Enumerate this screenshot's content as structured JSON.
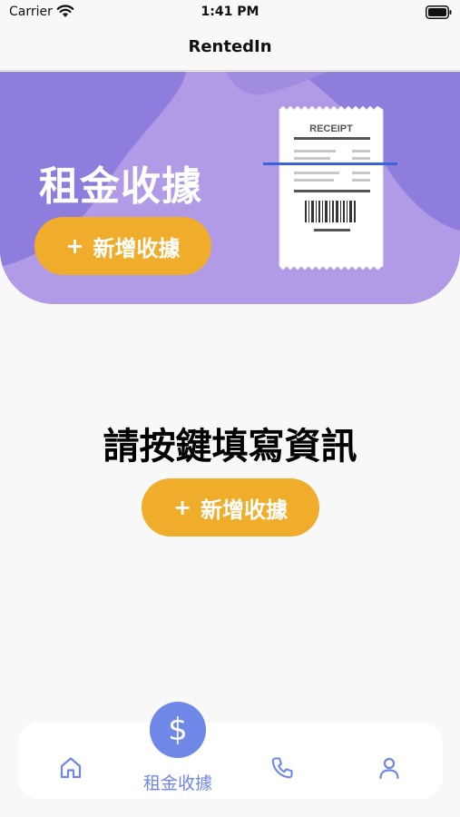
{
  "status_bar": {
    "carrier": "Carrier",
    "time": "1:41 PM",
    "icons": [
      "wifi-icon",
      "battery-icon"
    ]
  },
  "nav": {
    "title": "RentedIn"
  },
  "banner": {
    "title": "租金收據",
    "add_button_label": "新增收據",
    "add_button_icon": "plus-icon",
    "receipt_label": "RECEIPT"
  },
  "main": {
    "prompt": "請按鍵填寫資訊",
    "add_button_label": "新增收據",
    "add_button_icon": "plus-icon"
  },
  "tab_bar": {
    "items": [
      {
        "icon": "home-icon",
        "label": ""
      },
      {
        "icon": "dollar-icon",
        "label": "租金收據",
        "symbol": "$",
        "active": true
      },
      {
        "icon": "phone-icon",
        "label": ""
      },
      {
        "icon": "user-icon",
        "label": ""
      }
    ]
  },
  "colors": {
    "banner_purple": "#8e7ddc",
    "banner_light": "#b19be7",
    "accent_orange": "#efad2b",
    "tab_blue": "#6f88e8",
    "background": "#f8f8f8"
  }
}
